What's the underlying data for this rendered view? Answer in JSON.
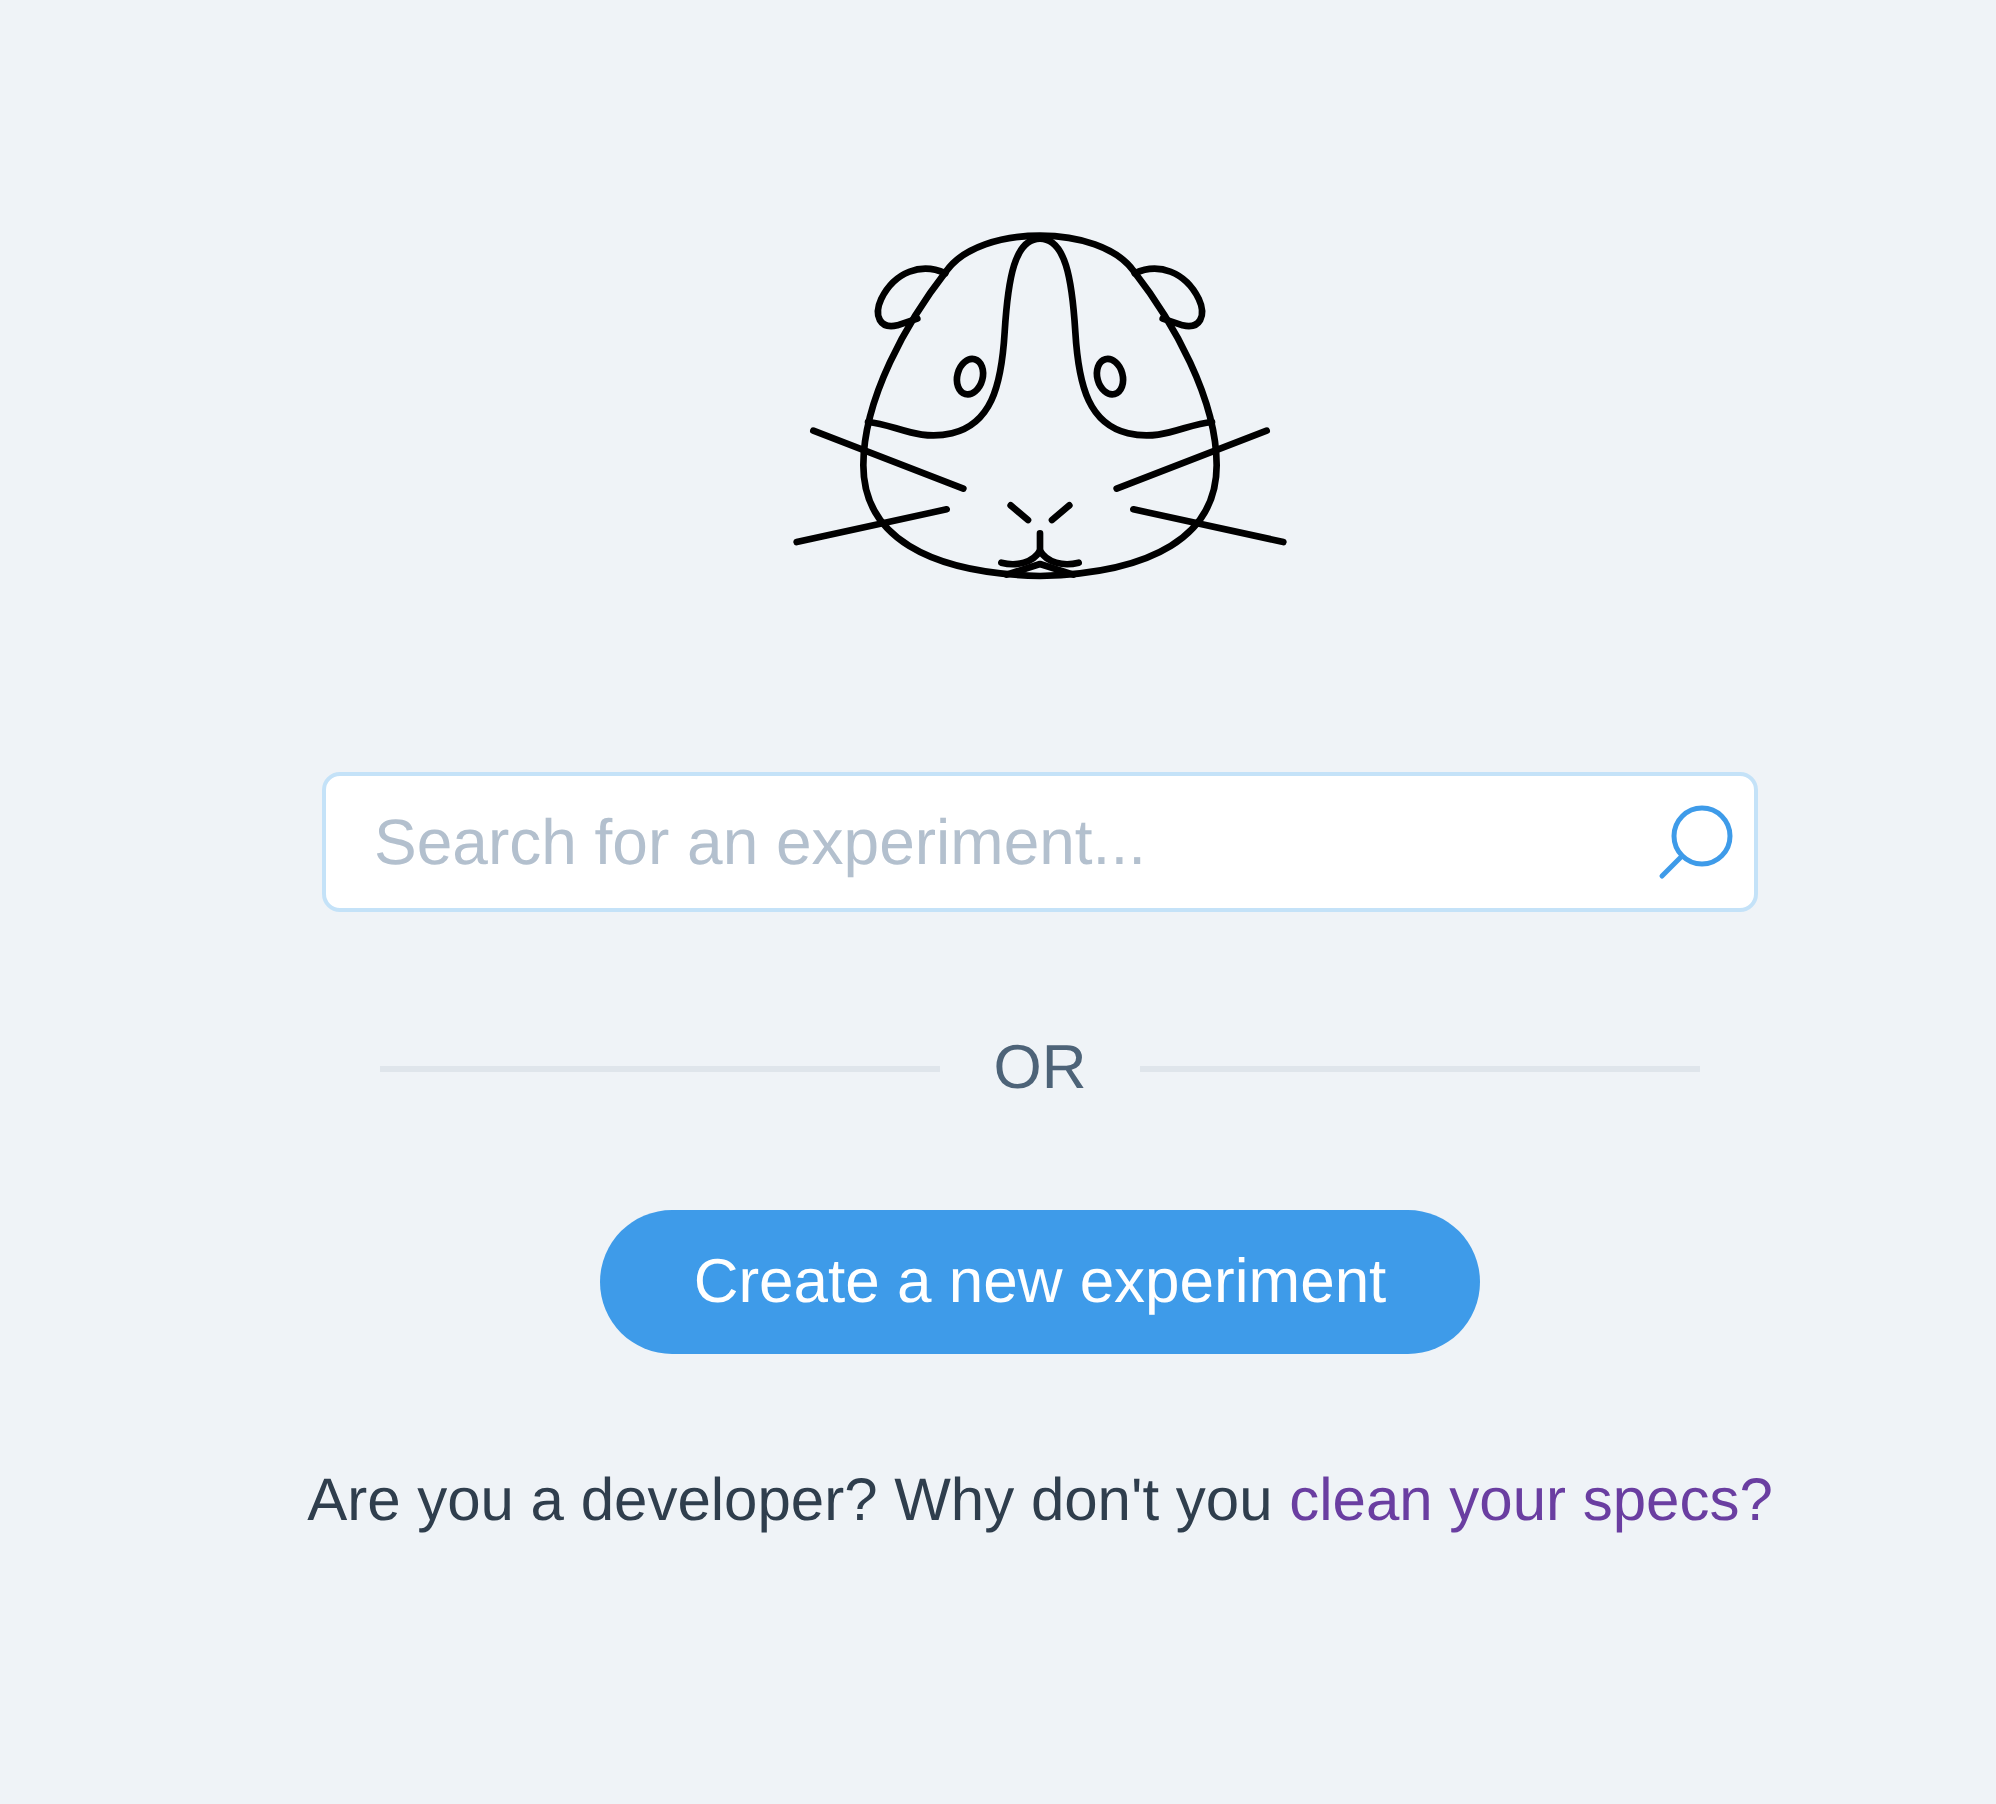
{
  "search": {
    "placeholder": "Search for an experiment..."
  },
  "divider": {
    "label": "OR"
  },
  "create_button": {
    "label": "Create a new experiment"
  },
  "footer": {
    "text": "Are you a developer? Why don't you",
    "link": "clean your specs?"
  }
}
